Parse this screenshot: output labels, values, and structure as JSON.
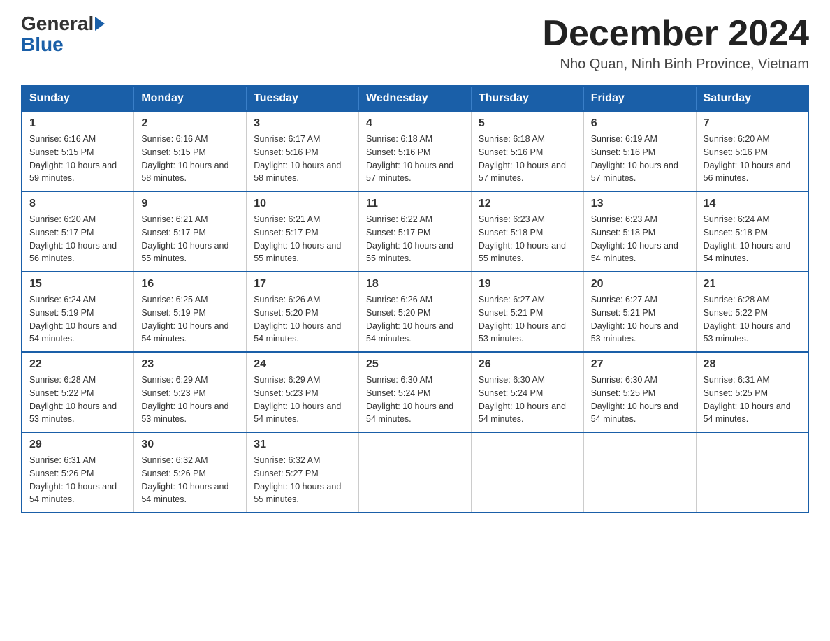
{
  "header": {
    "logo_general": "General",
    "logo_blue": "Blue",
    "month_year": "December 2024",
    "location": "Nho Quan, Ninh Binh Province, Vietnam"
  },
  "days_of_week": [
    "Sunday",
    "Monday",
    "Tuesday",
    "Wednesday",
    "Thursday",
    "Friday",
    "Saturday"
  ],
  "weeks": [
    [
      {
        "day": "1",
        "sunrise": "6:16 AM",
        "sunset": "5:15 PM",
        "daylight": "10 hours and 59 minutes."
      },
      {
        "day": "2",
        "sunrise": "6:16 AM",
        "sunset": "5:15 PM",
        "daylight": "10 hours and 58 minutes."
      },
      {
        "day": "3",
        "sunrise": "6:17 AM",
        "sunset": "5:16 PM",
        "daylight": "10 hours and 58 minutes."
      },
      {
        "day": "4",
        "sunrise": "6:18 AM",
        "sunset": "5:16 PM",
        "daylight": "10 hours and 57 minutes."
      },
      {
        "day": "5",
        "sunrise": "6:18 AM",
        "sunset": "5:16 PM",
        "daylight": "10 hours and 57 minutes."
      },
      {
        "day": "6",
        "sunrise": "6:19 AM",
        "sunset": "5:16 PM",
        "daylight": "10 hours and 57 minutes."
      },
      {
        "day": "7",
        "sunrise": "6:20 AM",
        "sunset": "5:16 PM",
        "daylight": "10 hours and 56 minutes."
      }
    ],
    [
      {
        "day": "8",
        "sunrise": "6:20 AM",
        "sunset": "5:17 PM",
        "daylight": "10 hours and 56 minutes."
      },
      {
        "day": "9",
        "sunrise": "6:21 AM",
        "sunset": "5:17 PM",
        "daylight": "10 hours and 55 minutes."
      },
      {
        "day": "10",
        "sunrise": "6:21 AM",
        "sunset": "5:17 PM",
        "daylight": "10 hours and 55 minutes."
      },
      {
        "day": "11",
        "sunrise": "6:22 AM",
        "sunset": "5:17 PM",
        "daylight": "10 hours and 55 minutes."
      },
      {
        "day": "12",
        "sunrise": "6:23 AM",
        "sunset": "5:18 PM",
        "daylight": "10 hours and 55 minutes."
      },
      {
        "day": "13",
        "sunrise": "6:23 AM",
        "sunset": "5:18 PM",
        "daylight": "10 hours and 54 minutes."
      },
      {
        "day": "14",
        "sunrise": "6:24 AM",
        "sunset": "5:18 PM",
        "daylight": "10 hours and 54 minutes."
      }
    ],
    [
      {
        "day": "15",
        "sunrise": "6:24 AM",
        "sunset": "5:19 PM",
        "daylight": "10 hours and 54 minutes."
      },
      {
        "day": "16",
        "sunrise": "6:25 AM",
        "sunset": "5:19 PM",
        "daylight": "10 hours and 54 minutes."
      },
      {
        "day": "17",
        "sunrise": "6:26 AM",
        "sunset": "5:20 PM",
        "daylight": "10 hours and 54 minutes."
      },
      {
        "day": "18",
        "sunrise": "6:26 AM",
        "sunset": "5:20 PM",
        "daylight": "10 hours and 54 minutes."
      },
      {
        "day": "19",
        "sunrise": "6:27 AM",
        "sunset": "5:21 PM",
        "daylight": "10 hours and 53 minutes."
      },
      {
        "day": "20",
        "sunrise": "6:27 AM",
        "sunset": "5:21 PM",
        "daylight": "10 hours and 53 minutes."
      },
      {
        "day": "21",
        "sunrise": "6:28 AM",
        "sunset": "5:22 PM",
        "daylight": "10 hours and 53 minutes."
      }
    ],
    [
      {
        "day": "22",
        "sunrise": "6:28 AM",
        "sunset": "5:22 PM",
        "daylight": "10 hours and 53 minutes."
      },
      {
        "day": "23",
        "sunrise": "6:29 AM",
        "sunset": "5:23 PM",
        "daylight": "10 hours and 53 minutes."
      },
      {
        "day": "24",
        "sunrise": "6:29 AM",
        "sunset": "5:23 PM",
        "daylight": "10 hours and 54 minutes."
      },
      {
        "day": "25",
        "sunrise": "6:30 AM",
        "sunset": "5:24 PM",
        "daylight": "10 hours and 54 minutes."
      },
      {
        "day": "26",
        "sunrise": "6:30 AM",
        "sunset": "5:24 PM",
        "daylight": "10 hours and 54 minutes."
      },
      {
        "day": "27",
        "sunrise": "6:30 AM",
        "sunset": "5:25 PM",
        "daylight": "10 hours and 54 minutes."
      },
      {
        "day": "28",
        "sunrise": "6:31 AM",
        "sunset": "5:25 PM",
        "daylight": "10 hours and 54 minutes."
      }
    ],
    [
      {
        "day": "29",
        "sunrise": "6:31 AM",
        "sunset": "5:26 PM",
        "daylight": "10 hours and 54 minutes."
      },
      {
        "day": "30",
        "sunrise": "6:32 AM",
        "sunset": "5:26 PM",
        "daylight": "10 hours and 54 minutes."
      },
      {
        "day": "31",
        "sunrise": "6:32 AM",
        "sunset": "5:27 PM",
        "daylight": "10 hours and 55 minutes."
      },
      null,
      null,
      null,
      null
    ]
  ],
  "labels": {
    "sunrise_prefix": "Sunrise: ",
    "sunset_prefix": "Sunset: ",
    "daylight_prefix": "Daylight: "
  }
}
